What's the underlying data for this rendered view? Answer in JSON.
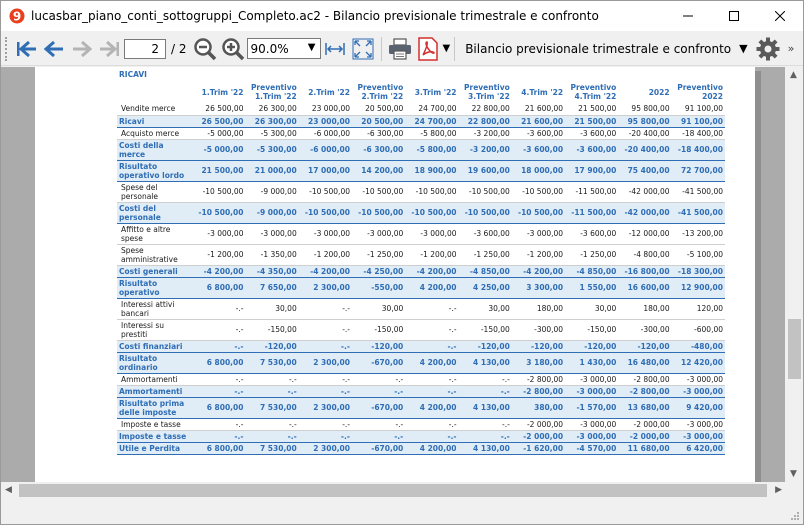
{
  "window": {
    "title": "lucasbar_piano_conti_sottogruppi_Completo.ac2 - Bilancio previsionale trimestrale e confronto",
    "minimize": "—",
    "maximize": "☐",
    "close": "✕"
  },
  "toolbar": {
    "page_current": "2",
    "page_total": "/ 2",
    "zoom": "90.0%",
    "report_name": "Bilancio previsionale trimestrale e confronto"
  },
  "report": {
    "section_title": "RICAVI",
    "headers": [
      "1.Trim '22",
      "Preventivo 1.Trim '22",
      "2.Trim '22",
      "Preventivo 2.Trim '22",
      "3.Trim '22",
      "Preventivo 3.Trim '22",
      "4.Trim '22",
      "Preventivo 4.Trim '22",
      "2022",
      "Preventivo 2022"
    ],
    "rows": [
      {
        "label": "Vendite merce",
        "kind": "plain",
        "values": [
          "26 500,00",
          "26 300,00",
          "23 000,00",
          "20 500,00",
          "24 700,00",
          "22 800,00",
          "21 600,00",
          "21 500,00",
          "95 800,00",
          "91 100,00"
        ]
      },
      {
        "label": "Ricavi",
        "kind": "total",
        "values": [
          "26 500,00",
          "26 300,00",
          "23 000,00",
          "20 500,00",
          "24 700,00",
          "22 800,00",
          "21 600,00",
          "21 500,00",
          "95 800,00",
          "91 100,00"
        ]
      },
      {
        "label": "Acquisto merce",
        "kind": "plain",
        "values": [
          "-5 000,00",
          "-5 300,00",
          "-6 000,00",
          "-6 300,00",
          "-5 800,00",
          "-3 200,00",
          "-3 600,00",
          "-3 600,00",
          "-20 400,00",
          "-18 400,00"
        ]
      },
      {
        "label": "Costi della merce",
        "kind": "total",
        "values": [
          "-5 000,00",
          "-5 300,00",
          "-6 000,00",
          "-6 300,00",
          "-5 800,00",
          "-3 200,00",
          "-3 600,00",
          "-3 600,00",
          "-20 400,00",
          "-18 400,00"
        ]
      },
      {
        "label": "Risultato operativo lordo",
        "kind": "total",
        "values": [
          "21 500,00",
          "21 000,00",
          "17 000,00",
          "14 200,00",
          "18 900,00",
          "19 600,00",
          "18 000,00",
          "17 900,00",
          "75 400,00",
          "72 700,00"
        ]
      },
      {
        "label": "Spese del personale",
        "kind": "plain",
        "values": [
          "-10 500,00",
          "-9 000,00",
          "-10 500,00",
          "-10 500,00",
          "-10 500,00",
          "-10 500,00",
          "-10 500,00",
          "-11 500,00",
          "-42 000,00",
          "-41 500,00"
        ]
      },
      {
        "label": "Costi del personale",
        "kind": "total",
        "values": [
          "-10 500,00",
          "-9 000,00",
          "-10 500,00",
          "-10 500,00",
          "-10 500,00",
          "-10 500,00",
          "-10 500,00",
          "-11 500,00",
          "-42 000,00",
          "-41 500,00"
        ]
      },
      {
        "label": "Affitto e altre spese",
        "kind": "plain",
        "values": [
          "-3 000,00",
          "-3 000,00",
          "-3 000,00",
          "-3 000,00",
          "-3 000,00",
          "-3 600,00",
          "-3 000,00",
          "-3 600,00",
          "-12 000,00",
          "-13 200,00"
        ]
      },
      {
        "label": "Spese amministrative",
        "kind": "plain",
        "values": [
          "-1 200,00",
          "-1 350,00",
          "-1 200,00",
          "-1 250,00",
          "-1 200,00",
          "-1 250,00",
          "-1 200,00",
          "-1 250,00",
          "-4 800,00",
          "-5 100,00"
        ]
      },
      {
        "label": "Costi generali",
        "kind": "total",
        "values": [
          "-4 200,00",
          "-4 350,00",
          "-4 200,00",
          "-4 250,00",
          "-4 200,00",
          "-4 850,00",
          "-4 200,00",
          "-4 850,00",
          "-16 800,00",
          "-18 300,00"
        ]
      },
      {
        "label": "Risultato operativo",
        "kind": "total",
        "values": [
          "6 800,00",
          "7 650,00",
          "2 300,00",
          "-550,00",
          "4 200,00",
          "4 250,00",
          "3 300,00",
          "1 550,00",
          "16 600,00",
          "12 900,00"
        ]
      },
      {
        "label": "Interessi attivi bancari",
        "kind": "plain",
        "values": [
          "-.-",
          "30,00",
          "-.-",
          "30,00",
          "-.-",
          "30,00",
          "180,00",
          "30,00",
          "180,00",
          "120,00"
        ]
      },
      {
        "label": "Interessi su prestiti",
        "kind": "plain",
        "values": [
          "-.-",
          "-150,00",
          "-.-",
          "-150,00",
          "-.-",
          "-150,00",
          "-300,00",
          "-150,00",
          "-300,00",
          "-600,00"
        ]
      },
      {
        "label": "Costi finanziari",
        "kind": "total",
        "values": [
          "-.-",
          "-120,00",
          "-.-",
          "-120,00",
          "-.-",
          "-120,00",
          "-120,00",
          "-120,00",
          "-120,00",
          "-480,00"
        ]
      },
      {
        "label": "Risultato ordinario",
        "kind": "total",
        "values": [
          "6 800,00",
          "7 530,00",
          "2 300,00",
          "-670,00",
          "4 200,00",
          "4 130,00",
          "3 180,00",
          "1 430,00",
          "16 480,00",
          "12 420,00"
        ]
      },
      {
        "label": "Ammortamenti",
        "kind": "plain",
        "values": [
          "-.-",
          "-.-",
          "-.-",
          "-.-",
          "-.-",
          "-.-",
          "-2 800,00",
          "-3 000,00",
          "-2 800,00",
          "-3 000,00"
        ]
      },
      {
        "label": "Ammortamenti",
        "kind": "total",
        "values": [
          "-.-",
          "-.-",
          "-.-",
          "-.-",
          "-.-",
          "-.-",
          "-2 800,00",
          "-3 000,00",
          "-2 800,00",
          "-3 000,00"
        ]
      },
      {
        "label": "Risultato prima delle imposte",
        "kind": "total",
        "values": [
          "6 800,00",
          "7 530,00",
          "2 300,00",
          "-670,00",
          "4 200,00",
          "4 130,00",
          "380,00",
          "-1 570,00",
          "13 680,00",
          "9 420,00"
        ]
      },
      {
        "label": "Imposte e tasse",
        "kind": "plain",
        "values": [
          "-.-",
          "-.-",
          "-.-",
          "-.-",
          "-.-",
          "-.-",
          "-2 000,00",
          "-3 000,00",
          "-2 000,00",
          "-3 000,00"
        ]
      },
      {
        "label": "Imposte e tasse",
        "kind": "total",
        "values": [
          "-.-",
          "-.-",
          "-.-",
          "-.-",
          "-.-",
          "-.-",
          "-2 000,00",
          "-3 000,00",
          "-2 000,00",
          "-3 000,00"
        ]
      },
      {
        "label": "Utile e Perdita",
        "kind": "total",
        "values": [
          "6 800,00",
          "7 530,00",
          "2 300,00",
          "-670,00",
          "4 200,00",
          "4 130,00",
          "-1 620,00",
          "-4 570,00",
          "11 680,00",
          "6 420,00"
        ]
      }
    ]
  },
  "colors": {
    "accent": "#2f6db5",
    "total_bg": "#e0edf6",
    "pdf_red": "#d32f2f"
  },
  "icons": [
    "app-logo-icon",
    "first-page-icon",
    "prev-page-icon",
    "next-page-icon",
    "last-page-icon",
    "zoom-out-icon",
    "zoom-in-icon",
    "fit-width-icon",
    "fit-page-icon",
    "print-icon",
    "pdf-icon",
    "settings-gear-icon"
  ]
}
